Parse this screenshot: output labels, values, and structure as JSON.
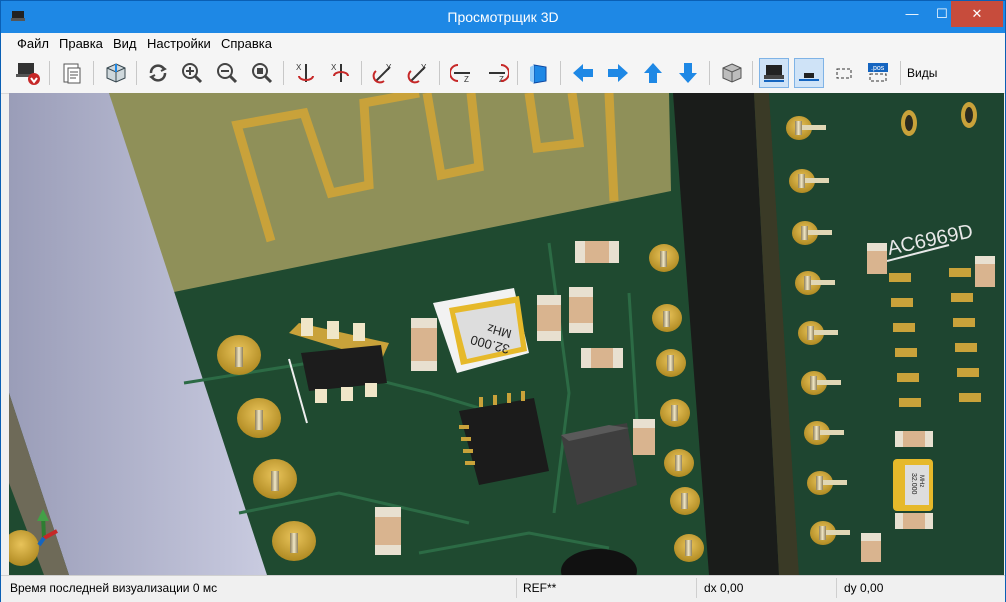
{
  "window": {
    "title": "Просмотрщик 3D",
    "controls": {
      "minimize": "—",
      "maximize": "☐",
      "close": "✕"
    }
  },
  "menu": {
    "items": [
      "Файл",
      "Правка",
      "Вид",
      "Настройки",
      "Справка"
    ]
  },
  "toolbar": {
    "views_label": "Виды",
    "pos_icon_text": ".pos"
  },
  "scene": {
    "crystal_main_label": "32.000\nMHz",
    "crystal_main_line1": "32.000",
    "crystal_main_line2": "MHz",
    "crystal_small_line1": "32.000",
    "crystal_small_line2": "MHz",
    "chip_label": "AC6969D",
    "colors": {
      "pcb": "#1f4a30",
      "copper": "#c9a23a",
      "antenna_area": "#8f9059",
      "module": "#1a1c1a"
    }
  },
  "status": {
    "render_time": "Время последней визуализации 0 мс",
    "ref": "REF**",
    "dx": "dx 0,00",
    "dy": "dy 0,00"
  }
}
